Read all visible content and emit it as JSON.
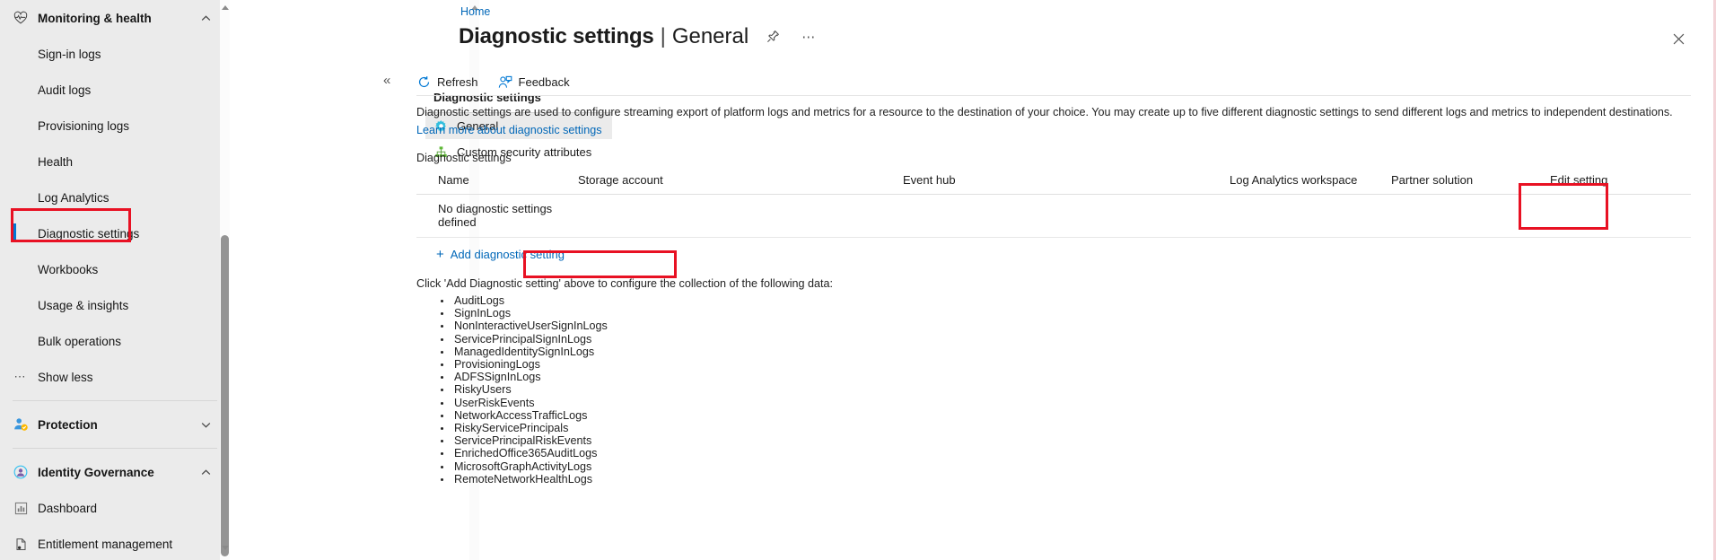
{
  "sidebar": {
    "items": [
      {
        "label": "Monitoring & health",
        "type": "group",
        "icon": "heart-pulse-icon",
        "chevron": "chevron-up-icon"
      },
      {
        "label": "Sign-in logs",
        "type": "child"
      },
      {
        "label": "Audit logs",
        "type": "child"
      },
      {
        "label": "Provisioning logs",
        "type": "child"
      },
      {
        "label": "Health",
        "type": "child"
      },
      {
        "label": "Log Analytics",
        "type": "child"
      },
      {
        "label": "Diagnostic settings",
        "type": "child",
        "selected": true,
        "highlighted": true
      },
      {
        "label": "Workbooks",
        "type": "child"
      },
      {
        "label": "Usage & insights",
        "type": "child"
      },
      {
        "label": "Bulk operations",
        "type": "child"
      },
      {
        "label": "Show less",
        "type": "showless",
        "icon": "ellipsis-icon"
      },
      {
        "label": "Protection",
        "type": "group",
        "icon": "user-shield-icon",
        "chevron": "chevron-down-icon"
      },
      {
        "label": "Identity Governance",
        "type": "group",
        "icon": "governance-icon",
        "chevron": "chevron-up-icon"
      },
      {
        "label": "Dashboard",
        "type": "child",
        "icon": "chart-icon"
      },
      {
        "label": "Entitlement management",
        "type": "child",
        "icon": "document-icon"
      }
    ]
  },
  "blade": {
    "breadcrumb": "Home",
    "title_main": "Diagnostic settings",
    "title_separator": "|",
    "title_sub": "General",
    "pin_icon": "pin-icon",
    "more_icon": "ellipsis-icon",
    "close_icon": "close-icon",
    "collapse_icon": "chevron-double-left-icon"
  },
  "blade_menu": {
    "title": "Diagnostic settings",
    "items": [
      {
        "label": "General",
        "icon": "gear-icon",
        "active": true
      },
      {
        "label": "Custom security attributes",
        "icon": "hierarchy-icon",
        "active": false
      }
    ]
  },
  "commandbar": {
    "buttons": [
      {
        "label": "Refresh",
        "icon": "refresh-icon"
      },
      {
        "label": "Feedback",
        "icon": "feedback-person-icon"
      }
    ]
  },
  "main": {
    "description": "Diagnostic settings are used to configure streaming export of platform logs and metrics for a resource to the destination of your choice. You may create up to five different diagnostic settings to send different logs and metrics to independent destinations. ",
    "description_link": "Learn more about diagnostic settings",
    "section_label": "Diagnostic settings",
    "table": {
      "headers": [
        "Name",
        "Storage account",
        "Event hub",
        "Log Analytics workspace",
        "Partner solution",
        "Edit setting"
      ],
      "empty_message": "No diagnostic settings defined"
    },
    "add_button": {
      "label": "Add diagnostic setting",
      "plus": "+"
    },
    "click_note": "Click 'Add Diagnostic setting' above to configure the collection of the following data:",
    "log_categories": [
      "AuditLogs",
      "SignInLogs",
      "NonInteractiveUserSignInLogs",
      "ServicePrincipalSignInLogs",
      "ManagedIdentitySignInLogs",
      "ProvisioningLogs",
      "ADFSSignInLogs",
      "RiskyUsers",
      "UserRiskEvents",
      "NetworkAccessTrafficLogs",
      "RiskyServicePrincipals",
      "ServicePrincipalRiskEvents",
      "EnrichedOffice365AuditLogs",
      "MicrosoftGraphActivityLogs",
      "RemoteNetworkHealthLogs"
    ]
  },
  "colors": {
    "accent": "#0078d4",
    "link": "#0067b8",
    "annotation": "#e81123",
    "sidebar_bg": "#ebebeb"
  }
}
